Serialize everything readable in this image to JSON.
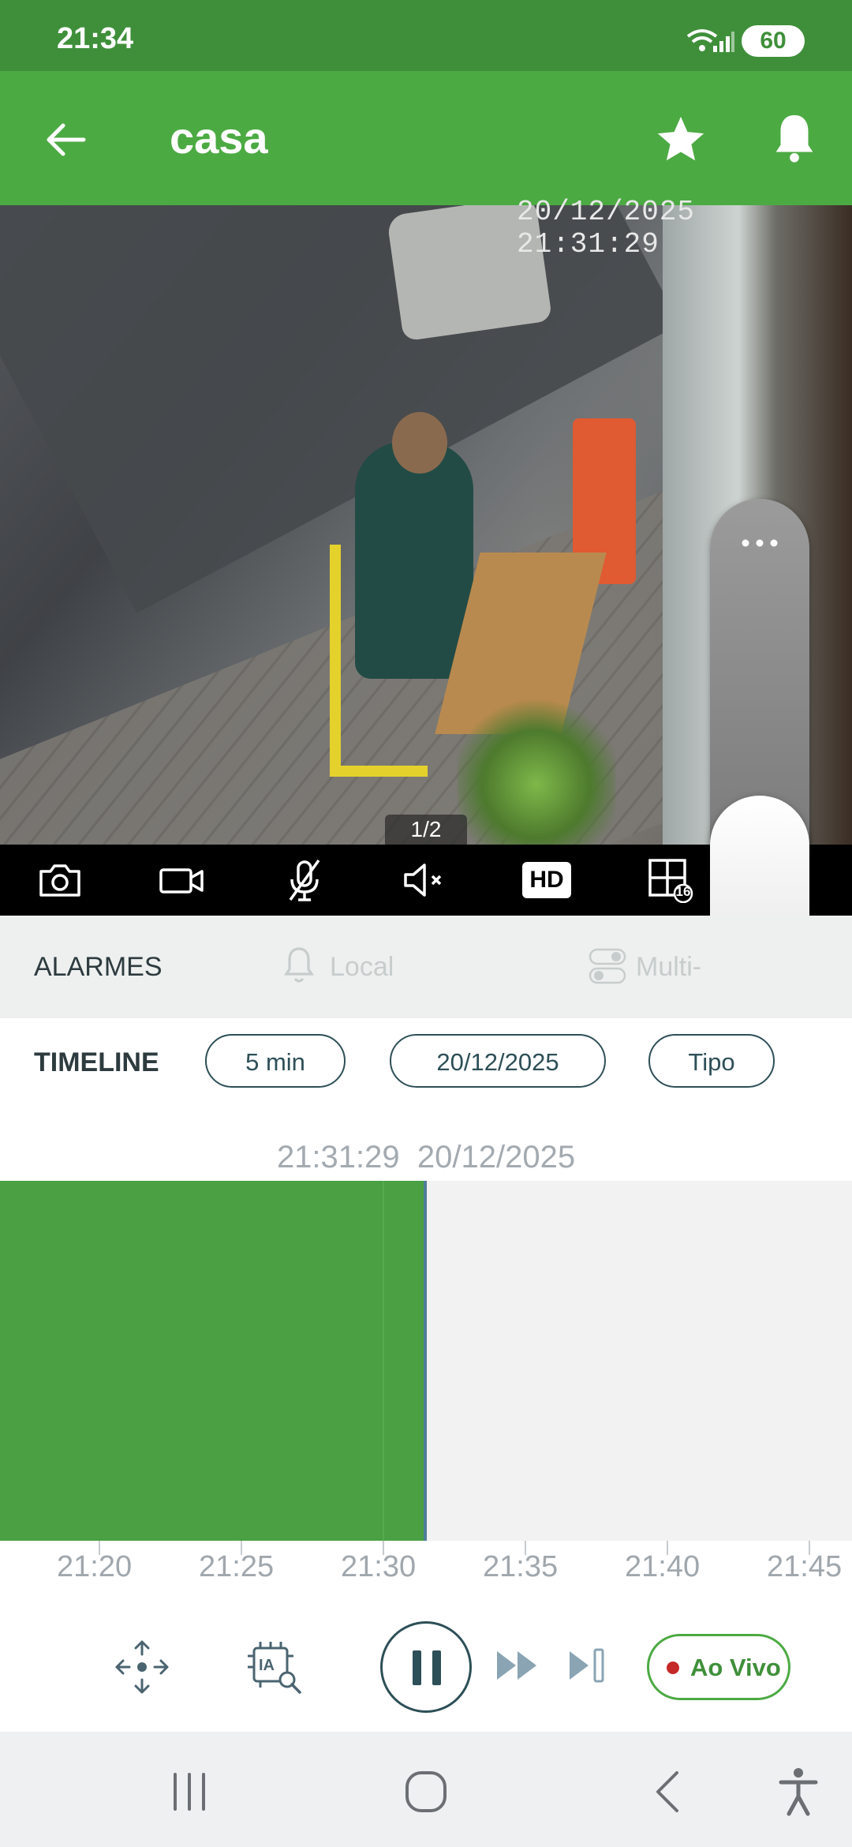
{
  "status_bar": {
    "time": "21:34",
    "battery": "60"
  },
  "header": {
    "title": "casa"
  },
  "video": {
    "timestamp": "20/12/2025 21:31:29",
    "page_indicator": "1/2"
  },
  "toolbar": {
    "hd_label": "HD",
    "grid_count": "16"
  },
  "alarms": {
    "label": "ALARMES",
    "local_label": "Local",
    "multi_label": "Multi-"
  },
  "timeline": {
    "label": "TIMELINE",
    "interval": "5 min",
    "date": "20/12/2025",
    "type": "Tipo",
    "current_time": "21:31:29  20/12/2025",
    "ticks": [
      "21:20",
      "21:25",
      "21:30",
      "21:35",
      "21:40",
      "21:45"
    ]
  },
  "controls": {
    "live_label": "Ao Vivo"
  },
  "colors": {
    "brand_green": "#4caa43",
    "status_green": "#3f8f3a",
    "recorded": "#4aa043",
    "live_dot": "#c62828"
  }
}
